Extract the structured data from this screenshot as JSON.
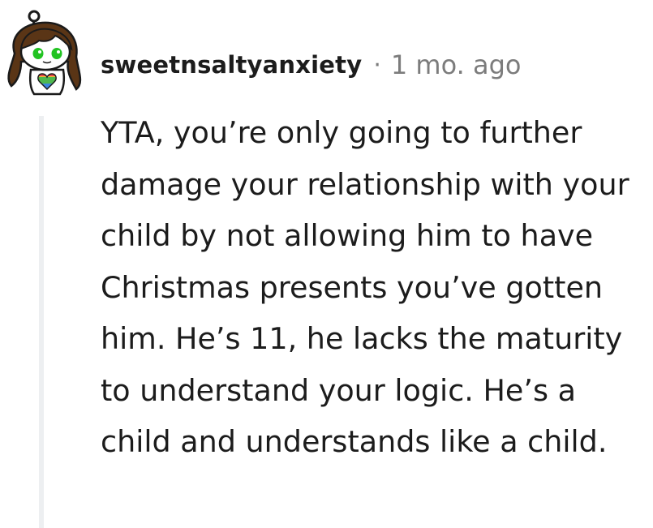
{
  "comment": {
    "username": "sweetnsaltyanxiety",
    "separator": "·",
    "timestamp": "1 mo. ago",
    "body": "YTA, you’re only going to further damage your relationship with your child by not allowing him to have Christmas presents you’ve gotten him. He’s 11, he lacks the maturity to understand your logic. He’s a child and understands like a child."
  },
  "avatar": {
    "icon": "snoo-avatar-brown-hair-green-eyes",
    "shirt_icon": "rainbow-heart-icon",
    "colors": {
      "hair": "#5a3516",
      "eyes": "#22c322",
      "skin": "#ffffff"
    }
  },
  "colors": {
    "text": "#1c1c1c",
    "meta": "#7c7c7c",
    "thread_line": "#edeff1"
  }
}
